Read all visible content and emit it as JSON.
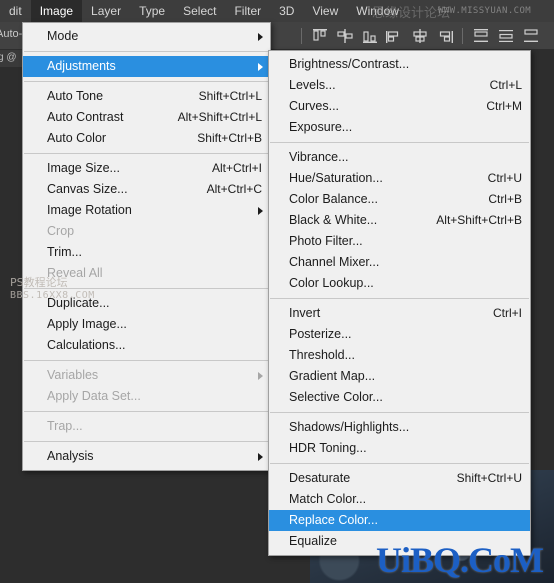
{
  "menubar": {
    "items": [
      {
        "label": "dit",
        "active": false
      },
      {
        "label": "Image",
        "active": true
      },
      {
        "label": "Layer",
        "active": false
      },
      {
        "label": "Type",
        "active": false
      },
      {
        "label": "Select",
        "active": false
      },
      {
        "label": "Filter",
        "active": false
      },
      {
        "label": "3D",
        "active": false
      },
      {
        "label": "View",
        "active": false
      },
      {
        "label": "Window",
        "active": false
      }
    ],
    "watermark_cn": "思缘设计论坛",
    "watermark_url": "WWW.MISSYUAN.COM"
  },
  "options_bar": {
    "auto_label": "Auto-",
    "align_icons": [
      "align-top-edges-icon",
      "align-vertical-centers-icon",
      "align-bottom-edges-icon",
      "align-left-edges-icon",
      "align-horizontal-centers-icon",
      "align-right-edges-icon",
      "distribute-top-edges-icon",
      "distribute-vertical-centers-icon",
      "distribute-bottom-edges-icon"
    ]
  },
  "doc_tab": {
    "label": "g @"
  },
  "image_menu": {
    "name": "Image",
    "items": [
      {
        "label": "Mode",
        "shortcut": "",
        "submenu": true,
        "disabled": false,
        "selected": false
      },
      {
        "type": "separator"
      },
      {
        "label": "Adjustments",
        "shortcut": "",
        "submenu": true,
        "disabled": false,
        "selected": true
      },
      {
        "type": "separator"
      },
      {
        "label": "Auto Tone",
        "shortcut": "Shift+Ctrl+L",
        "submenu": false,
        "disabled": false,
        "selected": false
      },
      {
        "label": "Auto Contrast",
        "shortcut": "Alt+Shift+Ctrl+L",
        "submenu": false,
        "disabled": false,
        "selected": false
      },
      {
        "label": "Auto Color",
        "shortcut": "Shift+Ctrl+B",
        "submenu": false,
        "disabled": false,
        "selected": false
      },
      {
        "type": "separator"
      },
      {
        "label": "Image Size...",
        "shortcut": "Alt+Ctrl+I",
        "submenu": false,
        "disabled": false,
        "selected": false
      },
      {
        "label": "Canvas Size...",
        "shortcut": "Alt+Ctrl+C",
        "submenu": false,
        "disabled": false,
        "selected": false
      },
      {
        "label": "Image Rotation",
        "shortcut": "",
        "submenu": true,
        "disabled": false,
        "selected": false
      },
      {
        "label": "Crop",
        "shortcut": "",
        "submenu": false,
        "disabled": true,
        "selected": false
      },
      {
        "label": "Trim...",
        "shortcut": "",
        "submenu": false,
        "disabled": false,
        "selected": false
      },
      {
        "label": "Reveal All",
        "shortcut": "",
        "submenu": false,
        "disabled": true,
        "selected": false
      },
      {
        "type": "separator"
      },
      {
        "label": "Duplicate...",
        "shortcut": "",
        "submenu": false,
        "disabled": false,
        "selected": false
      },
      {
        "label": "Apply Image...",
        "shortcut": "",
        "submenu": false,
        "disabled": false,
        "selected": false
      },
      {
        "label": "Calculations...",
        "shortcut": "",
        "submenu": false,
        "disabled": false,
        "selected": false
      },
      {
        "type": "separator"
      },
      {
        "label": "Variables",
        "shortcut": "",
        "submenu": true,
        "disabled": true,
        "selected": false
      },
      {
        "label": "Apply Data Set...",
        "shortcut": "",
        "submenu": false,
        "disabled": true,
        "selected": false
      },
      {
        "type": "separator"
      },
      {
        "label": "Trap...",
        "shortcut": "",
        "submenu": false,
        "disabled": true,
        "selected": false
      },
      {
        "type": "separator"
      },
      {
        "label": "Analysis",
        "shortcut": "",
        "submenu": true,
        "disabled": false,
        "selected": false
      }
    ]
  },
  "adjustments_menu": {
    "name": "Adjustments",
    "items": [
      {
        "label": "Brightness/Contrast...",
        "shortcut": "",
        "submenu": false,
        "disabled": false,
        "selected": false
      },
      {
        "label": "Levels...",
        "shortcut": "Ctrl+L",
        "submenu": false,
        "disabled": false,
        "selected": false
      },
      {
        "label": "Curves...",
        "shortcut": "Ctrl+M",
        "submenu": false,
        "disabled": false,
        "selected": false
      },
      {
        "label": "Exposure...",
        "shortcut": "",
        "submenu": false,
        "disabled": false,
        "selected": false
      },
      {
        "type": "separator"
      },
      {
        "label": "Vibrance...",
        "shortcut": "",
        "submenu": false,
        "disabled": false,
        "selected": false
      },
      {
        "label": "Hue/Saturation...",
        "shortcut": "Ctrl+U",
        "submenu": false,
        "disabled": false,
        "selected": false
      },
      {
        "label": "Color Balance...",
        "shortcut": "Ctrl+B",
        "submenu": false,
        "disabled": false,
        "selected": false
      },
      {
        "label": "Black & White...",
        "shortcut": "Alt+Shift+Ctrl+B",
        "submenu": false,
        "disabled": false,
        "selected": false
      },
      {
        "label": "Photo Filter...",
        "shortcut": "",
        "submenu": false,
        "disabled": false,
        "selected": false
      },
      {
        "label": "Channel Mixer...",
        "shortcut": "",
        "submenu": false,
        "disabled": false,
        "selected": false
      },
      {
        "label": "Color Lookup...",
        "shortcut": "",
        "submenu": false,
        "disabled": false,
        "selected": false
      },
      {
        "type": "separator"
      },
      {
        "label": "Invert",
        "shortcut": "Ctrl+I",
        "submenu": false,
        "disabled": false,
        "selected": false
      },
      {
        "label": "Posterize...",
        "shortcut": "",
        "submenu": false,
        "disabled": false,
        "selected": false
      },
      {
        "label": "Threshold...",
        "shortcut": "",
        "submenu": false,
        "disabled": false,
        "selected": false
      },
      {
        "label": "Gradient Map...",
        "shortcut": "",
        "submenu": false,
        "disabled": false,
        "selected": false
      },
      {
        "label": "Selective Color...",
        "shortcut": "",
        "submenu": false,
        "disabled": false,
        "selected": false
      },
      {
        "type": "separator"
      },
      {
        "label": "Shadows/Highlights...",
        "shortcut": "",
        "submenu": false,
        "disabled": false,
        "selected": false
      },
      {
        "label": "HDR Toning...",
        "shortcut": "",
        "submenu": false,
        "disabled": false,
        "selected": false
      },
      {
        "type": "separator"
      },
      {
        "label": "Desaturate",
        "shortcut": "Shift+Ctrl+U",
        "submenu": false,
        "disabled": false,
        "selected": false
      },
      {
        "label": "Match Color...",
        "shortcut": "",
        "submenu": false,
        "disabled": false,
        "selected": false
      },
      {
        "label": "Replace Color...",
        "shortcut": "",
        "submenu": false,
        "disabled": false,
        "selected": true
      },
      {
        "label": "Equalize",
        "shortcut": "",
        "submenu": false,
        "disabled": false,
        "selected": false
      }
    ]
  },
  "watermarks": {
    "ps_forum_line1": "PS教程论坛",
    "ps_forum_line2": "BBS.16XX8.COM",
    "uibq": "UiBQ.CoM"
  },
  "colors": {
    "highlight": "#2a8fe0",
    "menu_bg": "#f0f0f0",
    "menubar_bg": "#3d3d3d",
    "canvas_bg": "#2d2d2d",
    "watermark_blue": "#1c5fc4"
  }
}
